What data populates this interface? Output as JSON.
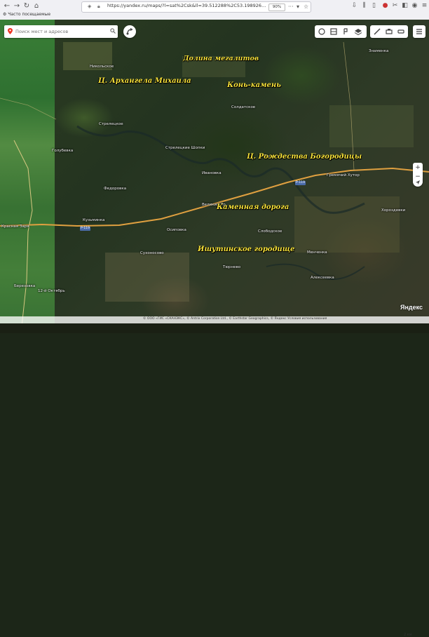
{
  "browser": {
    "url": "https://yandex.ru/maps/?l=sat%2Csk&ll=39.512288%2C53.198926...",
    "zoom": "90%",
    "bookmark": "Часто посещаемые"
  },
  "search": {
    "placeholder": "Поиск мест и адресов"
  },
  "annotations": [
    {
      "text": "Долина мегалитов"
    },
    {
      "text": "Ц. Архангела Михаила"
    },
    {
      "text": "Конь-камень"
    },
    {
      "text": "Ц. Рождества Богородицы"
    },
    {
      "text": "Каменная дорога"
    },
    {
      "text": "Ишутинское городище"
    }
  ],
  "places": [
    {
      "text": "Солдатское"
    },
    {
      "text": "Знаменка"
    },
    {
      "text": "Стрелецкие Шопки"
    },
    {
      "text": "Гремячий Хутор"
    },
    {
      "text": "Федоровка"
    },
    {
      "text": "Хороздевки"
    },
    {
      "text": "Красная Заря"
    },
    {
      "text": "Слободское"
    },
    {
      "text": "Кузьминка"
    },
    {
      "text": "Менченка"
    },
    {
      "text": "Сухоносово"
    },
    {
      "text": "Тюрнево"
    },
    {
      "text": "Алексеевка"
    },
    {
      "text": "Березовка"
    },
    {
      "text": "Ивановка"
    },
    {
      "text": "Великий Яр"
    },
    {
      "text": "Голубевка"
    },
    {
      "text": "12-й Октябрь"
    },
    {
      "text": "Никольское"
    },
    {
      "text": "Гремячье"
    },
    {
      "text": "Стрелецкое"
    },
    {
      "text": "Осиповка"
    }
  ],
  "roads": [
    {
      "text": "Р-119"
    },
    {
      "text": "Р-119"
    }
  ],
  "footer": {
    "logo": "Яндекс",
    "attribution": "© ООО «ГИС «СКАНЭКС», © Antrix Corporation Ltd., © Earthstar Geographics, © Яндекс Условия использования",
    "scale": "2 км"
  },
  "colors": {
    "annotation": "#f5e13a",
    "road": "#e0a040"
  }
}
